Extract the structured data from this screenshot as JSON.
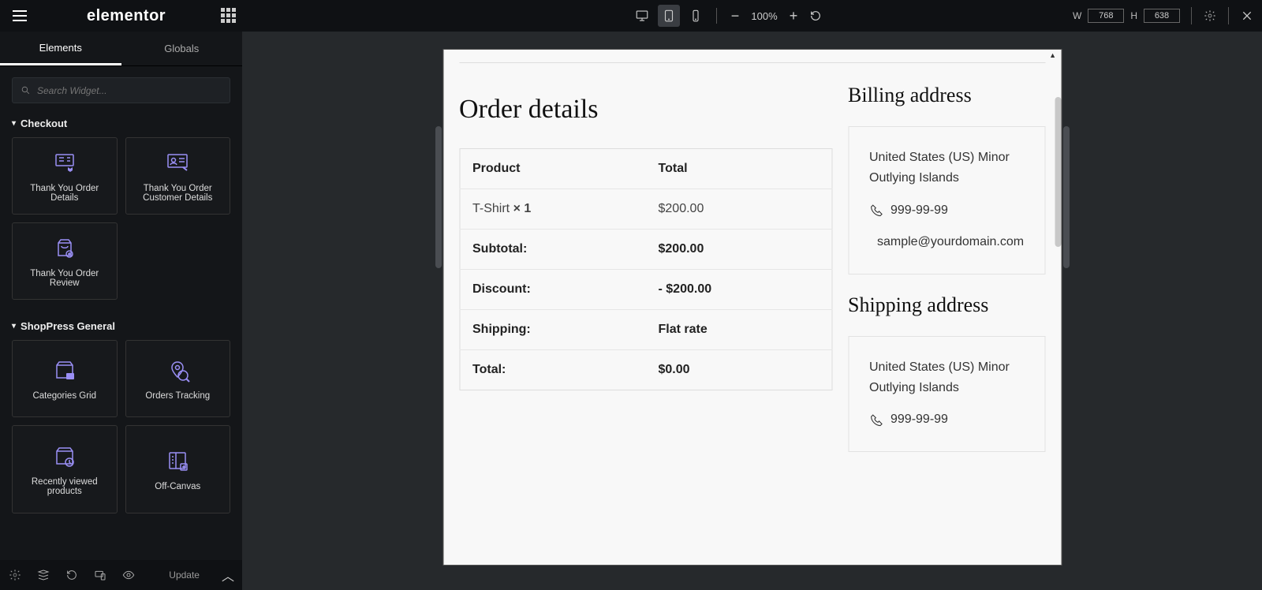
{
  "header": {
    "brand": "elementor",
    "zoom": "100%",
    "w_label": "W",
    "h_label": "H",
    "w_value": "768",
    "h_value": "638"
  },
  "sidebar": {
    "tabs": {
      "elements": "Elements",
      "globals": "Globals"
    },
    "search_placeholder": "Search Widget...",
    "categories": [
      {
        "title": "Checkout",
        "widgets": [
          {
            "label": "Thank You Order Details"
          },
          {
            "label": "Thank You Order Customer Details"
          },
          {
            "label": "Thank You Order Review"
          }
        ]
      },
      {
        "title": "ShopPress General",
        "widgets": [
          {
            "label": "Categories Grid"
          },
          {
            "label": "Orders Tracking"
          },
          {
            "label": "Recently viewed products"
          },
          {
            "label": "Off-Canvas"
          }
        ]
      }
    ]
  },
  "bottom": {
    "update": "Update"
  },
  "preview": {
    "order_title": "Order details",
    "table": {
      "header": {
        "product": "Product",
        "total": "Total"
      },
      "item": {
        "name": "T-Shirt",
        "qty_sep": "× 1",
        "total": "$200.00"
      },
      "subtotal": {
        "label": "Subtotal:",
        "value": "$200.00"
      },
      "discount": {
        "label": "Discount:",
        "value": "- $200.00"
      },
      "shipping": {
        "label": "Shipping:",
        "value": "Flat rate"
      },
      "total": {
        "label": "Total:",
        "value": "$0.00"
      }
    },
    "billing_title": "Billing address",
    "shipping_title": "Shipping address",
    "address": {
      "text": "United States (US) Minor Outlying Islands",
      "phone": "999-99-99",
      "email": "sample@yourdomain.com"
    }
  }
}
